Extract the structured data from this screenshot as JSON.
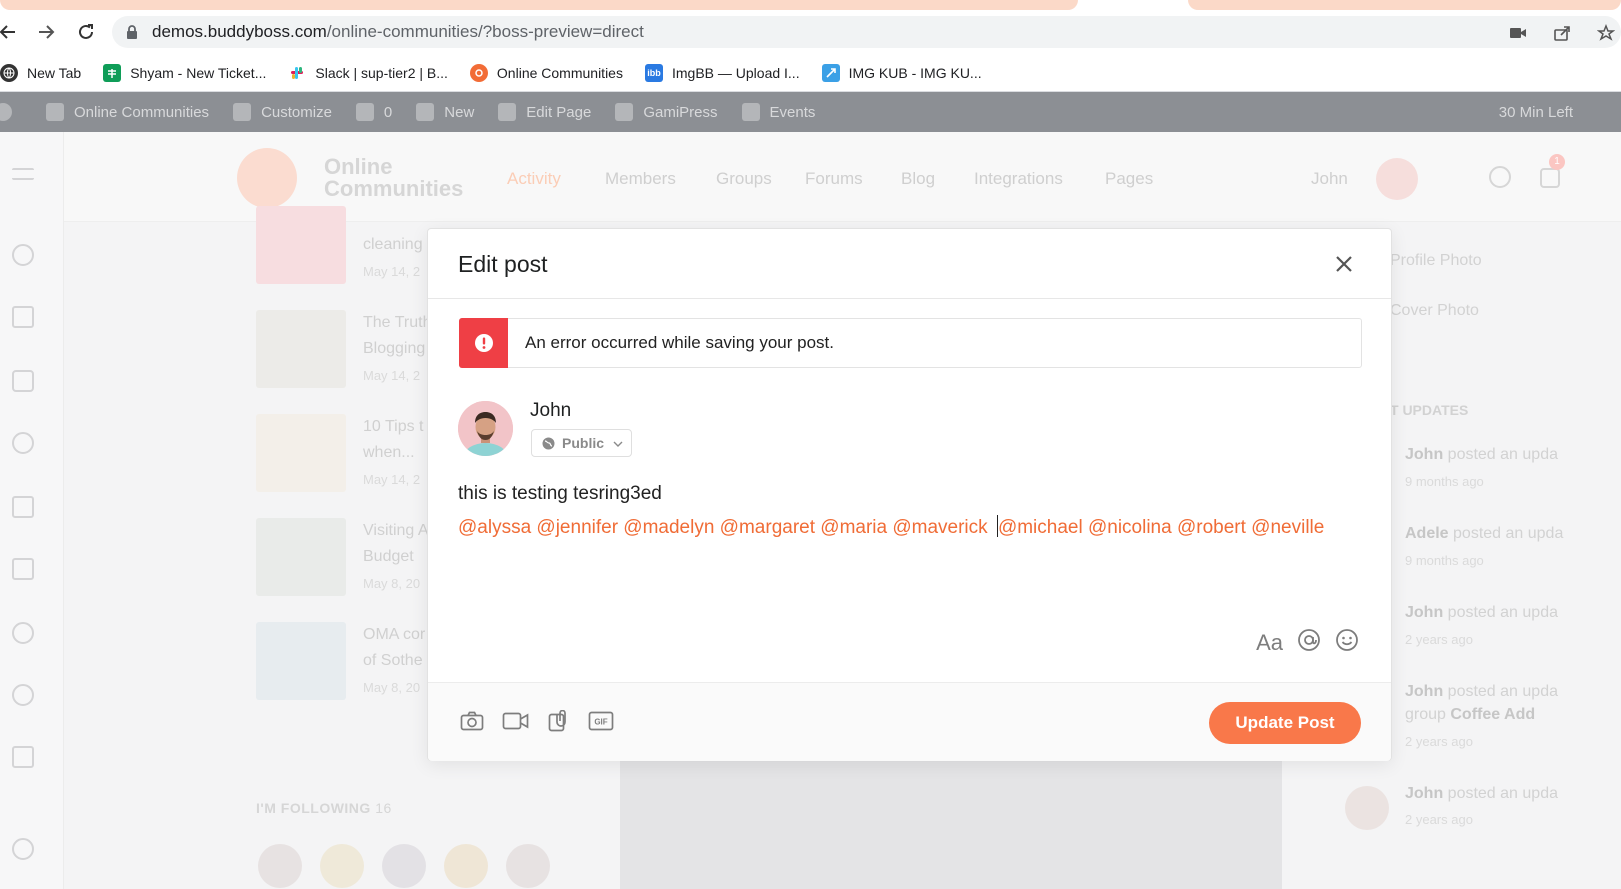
{
  "browser": {
    "url_host": "demos.buddyboss.com",
    "url_path": "/online-communities/?boss-preview=direct",
    "bookmarks": [
      {
        "label": "New Tab",
        "icon": "globe-icon",
        "color": "#333333"
      },
      {
        "label": "Shyam - New Ticket...",
        "icon": "sheets-icon",
        "color": "#0f9d58"
      },
      {
        "label": "Slack | sup-tier2 | B...",
        "icon": "slack-icon",
        "color": "#e01e5a"
      },
      {
        "label": "Online Communities",
        "icon": "buddyboss-icon",
        "color": "#f26c36"
      },
      {
        "label": "ImgBB — Upload I...",
        "icon": "imgbb-icon",
        "color": "#2a7ae2"
      },
      {
        "label": "IMG KUB - IMG KU...",
        "icon": "imgkub-icon",
        "color": "#3ba0e6"
      }
    ]
  },
  "adminbar": {
    "items": [
      "Online Communities",
      "Customize",
      "0",
      "New",
      "Edit Page",
      "GamiPress",
      "Events"
    ],
    "right": "30 Min Left"
  },
  "site": {
    "logo_line1": "Online",
    "logo_line2": "Communities",
    "nav": [
      "Activity",
      "Members",
      "Groups",
      "Forums",
      "Blog",
      "Integrations",
      "Pages"
    ],
    "user": "John",
    "notification_count": "1",
    "feed": [
      {
        "title1": "cleaning",
        "title2": "",
        "date": "May 14, 2"
      },
      {
        "title1": "The Truth",
        "title2": "Blogging",
        "date": "May 14, 2"
      },
      {
        "title1": "10 Tips t",
        "title2": "when...",
        "date": "May 14, 2"
      },
      {
        "title1": "Visiting A",
        "title2": "Budget",
        "date": "May 8, 20"
      },
      {
        "title1": "OMA cor",
        "title2": "of Sothe",
        "date": "May 8, 20"
      }
    ],
    "right_links": [
      "Profile Photo",
      "Cover Photo"
    ],
    "updates_heading": "T UPDATES",
    "updates": [
      {
        "name": "John",
        "text": " posted an upda",
        "time": "9 months ago"
      },
      {
        "name": "Adele",
        "text": " posted an upda",
        "time": "9 months ago"
      },
      {
        "name": "John",
        "text": " posted an upda",
        "time": "2 years ago"
      },
      {
        "name": "John",
        "text": " posted an upda",
        "time": "2 years ago"
      },
      {
        "name": "John",
        "text": " posted an upda",
        "time": "2 years ago"
      }
    ],
    "update_group_line": "group",
    "update_group_name": "Coffee Add",
    "following_label": "I'M FOLLOWING",
    "following_count": "16"
  },
  "modal": {
    "title": "Edit post",
    "error": "An error occurred while saving your post.",
    "author": "John",
    "privacy": "Public",
    "text_line1": "this is testing tesring3ed",
    "mentions_before_caret": "@alyssa @jennifer @madelyn @margaret @maria @maverick ",
    "mentions_after_caret": "@michael @nicolina @robert @neville",
    "format_label": "Aa",
    "submit_label": "Update Post",
    "colors": {
      "accent": "#f9784a",
      "error": "#ef3f45",
      "mention": "#f06c36"
    }
  }
}
